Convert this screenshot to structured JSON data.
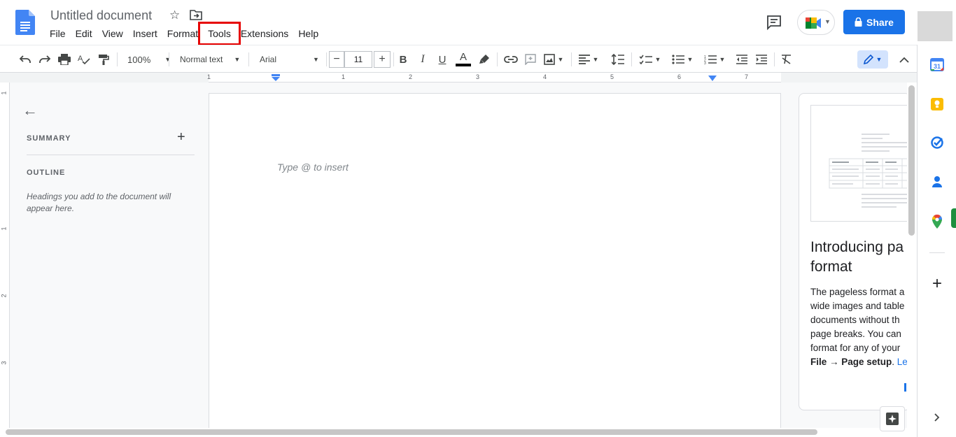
{
  "document": {
    "title": "Untitled document",
    "star_icon": "star-icon",
    "move_icon": "folder-move-icon"
  },
  "menu": {
    "items": [
      {
        "label": "File"
      },
      {
        "label": "Edit"
      },
      {
        "label": "View"
      },
      {
        "label": "Insert"
      },
      {
        "label": "Format"
      },
      {
        "label": "Tools",
        "highlighted": true
      },
      {
        "label": "Extensions"
      },
      {
        "label": "Help"
      }
    ]
  },
  "header": {
    "share_label": "Share",
    "share_color": "#1a73e8",
    "highlight_color": "#e60000"
  },
  "toolbar": {
    "zoom": "100%",
    "style": "Normal text",
    "font": "Arial",
    "font_size": "11"
  },
  "ruler": {
    "horizontal_ticks": [
      "1",
      "1",
      "2",
      "3",
      "4",
      "5",
      "6",
      "7"
    ],
    "vertical_ticks": [
      "1",
      "1",
      "2",
      "3"
    ]
  },
  "outline": {
    "summary_label": "SUMMARY",
    "outline_label": "OUTLINE",
    "empty_note": "Headings you add to the document will appear here."
  },
  "page": {
    "placeholder": "Type @ to insert"
  },
  "card": {
    "title_line1": "Introducing pa",
    "title_line2": "format",
    "body_lines": [
      "The pageless format a",
      "wide images and table",
      "documents without th",
      "page breaks. You can",
      "format for any of your"
    ],
    "bold_text": "File → Page setup",
    "link_text": "Le"
  }
}
